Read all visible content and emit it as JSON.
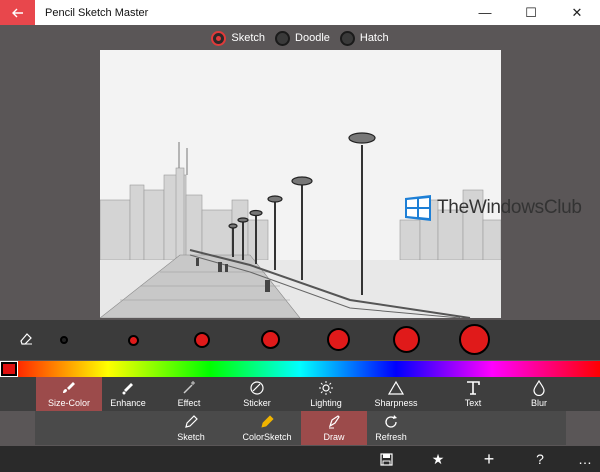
{
  "window": {
    "title": "Pencil Sketch Master",
    "minimize": "—",
    "maximize": "☐",
    "close": "✕"
  },
  "modes": [
    {
      "label": "Sketch",
      "selected": true
    },
    {
      "label": "Doodle",
      "selected": false
    },
    {
      "label": "Hatch",
      "selected": false
    }
  ],
  "watermark": {
    "text": "TheWindowsClub"
  },
  "colors": {
    "accent": "#e8474c",
    "active_tool": "#9c4b4b",
    "brush": "#e01a1a"
  },
  "tools": [
    {
      "label": "Size-Color",
      "icon": "brush-icon",
      "active": true
    },
    {
      "label": "Enhance",
      "icon": "wand-icon",
      "active": false
    },
    {
      "label": "Effect",
      "icon": "sparkle-wand-icon",
      "active": false
    },
    {
      "label": "Sticker",
      "icon": "sticker-icon",
      "active": false
    },
    {
      "label": "Lighting",
      "icon": "sun-icon",
      "active": false
    },
    {
      "label": "Sharpness",
      "icon": "triangle-icon",
      "active": false
    },
    {
      "label": "Text",
      "icon": "text-t-icon",
      "active": false
    },
    {
      "label": "Blur",
      "icon": "drop-icon",
      "active": false
    }
  ],
  "sub_tools": [
    {
      "label": "Sketch",
      "icon": "pencil-icon",
      "active": false
    },
    {
      "label": "ColorSketch",
      "icon": "color-pencil-icon",
      "active": false
    },
    {
      "label": "Draw",
      "icon": "pen-icon",
      "active": true
    },
    {
      "label": "Refresh",
      "icon": "refresh-icon",
      "active": false
    }
  ],
  "bottom": {
    "save": "🖫",
    "favorite": "★",
    "add": "+",
    "help": "?",
    "more": "…"
  }
}
